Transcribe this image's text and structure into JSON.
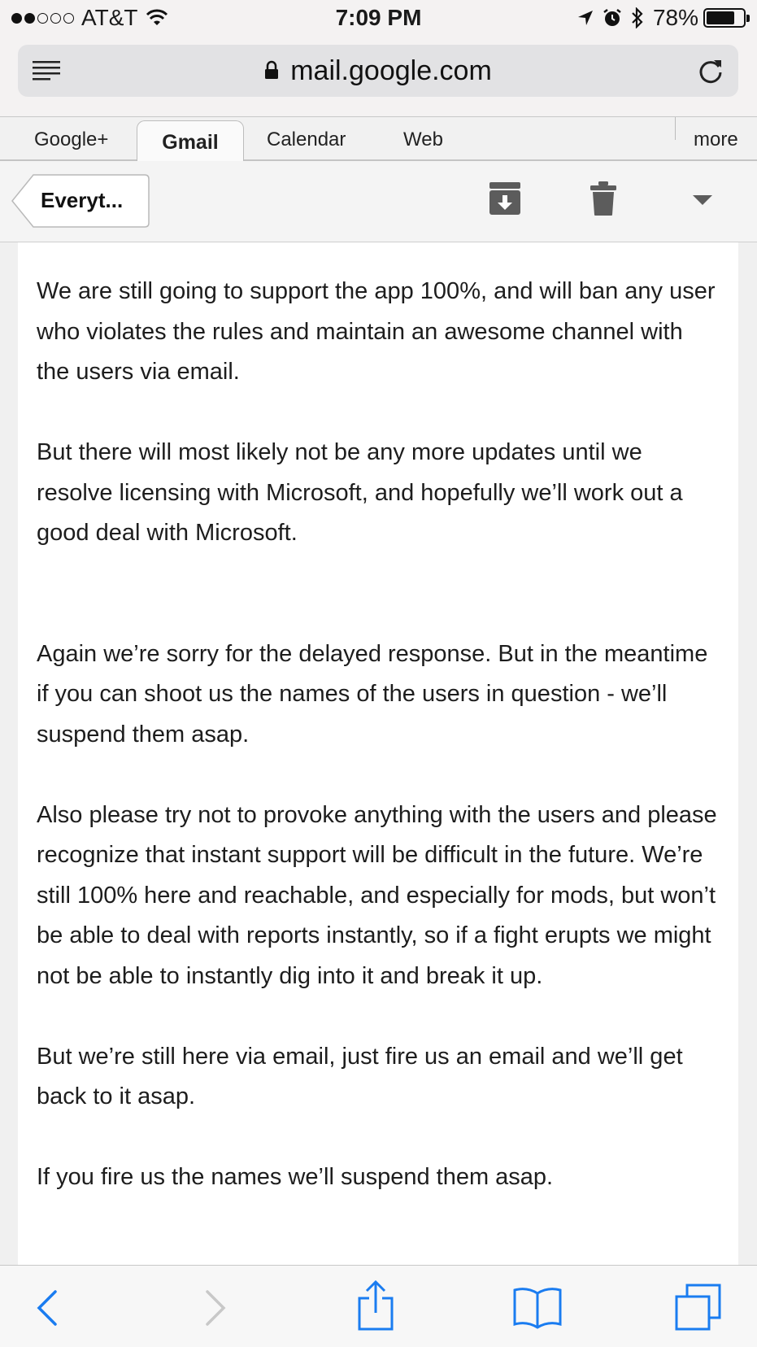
{
  "status_bar": {
    "carrier": "AT&T",
    "time": "7:09 PM",
    "battery_percent": "78%",
    "battery_level": 0.78,
    "signal_bars_filled": 2,
    "signal_bars_total": 5
  },
  "browser": {
    "url": "mail.google.com"
  },
  "google_nav": {
    "items": [
      "Google+",
      "Gmail",
      "Calendar",
      "Web"
    ],
    "active": "Gmail",
    "more_label": "more"
  },
  "toolbar": {
    "back_label": "Everyt..."
  },
  "email": {
    "paragraphs": [
      "We are still going to support the app 100%, and will ban any user who violates the rules and maintain an awesome channel with the users via email.",
      "But there will most likely not be any more updates until we resolve licensing with Microsoft, and hopefully we’ll work out a good deal with Microsoft.",
      "Again we’re sorry for the delayed response. But in the meantime if you can shoot us the names of the users in question - we’ll suspend them asap.",
      "Also please try not to provoke anything with the users and please recognize that instant support will be difficult in the future. We’re still 100% here and reachable, and especially for mods, but won’t be able to deal with reports instantly, so if a fight erupts we might not be able to instantly dig into it and break it up.",
      "But we’re still here via email, just fire us an email and we’ll get back to it asap.",
      "If you fire us the names we’ll suspend them asap."
    ]
  },
  "colors": {
    "accent": "#1a7cf0",
    "icon_gray": "#555555",
    "disabled": "#c8c8c8"
  }
}
